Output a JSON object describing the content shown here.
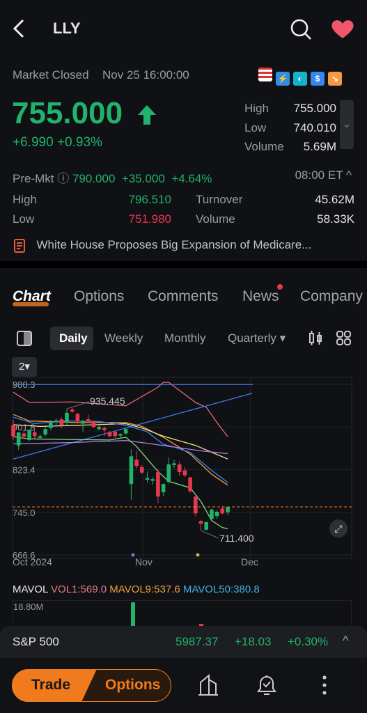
{
  "header": {
    "title": "LLY",
    "back_icon": "chevron-left",
    "search_icon": "search",
    "favorite_icon": "heart",
    "favorite_color": "#f0566c"
  },
  "status": {
    "market": "Market Closed",
    "time": "Nov 25 16:00:00"
  },
  "badges": [
    "us-flag",
    "lightning-2",
    "logo-teal",
    "dollar",
    "trend-down"
  ],
  "quote": {
    "price": "755.000",
    "change": "+6.990",
    "change_pct": "+0.93%",
    "high_label": "High",
    "high": "755.000",
    "low_label": "Low",
    "low": "740.010",
    "volume_label": "Volume",
    "volume": "5.69M"
  },
  "premarket": {
    "label": "Pre-Mkt",
    "price": "790.000",
    "change": "+35.000",
    "change_pct": "+4.64%",
    "time": "08:00 ET",
    "high_label": "High",
    "high": "796.510",
    "low_label": "Low",
    "low": "751.980",
    "turnover_label": "Turnover",
    "turnover": "45.62M",
    "volume_label": "Volume",
    "volume": "58.33K"
  },
  "news": {
    "headline": "White House Proposes Big Expansion of Medicare..."
  },
  "tabs": [
    {
      "label": "Chart",
      "active": true
    },
    {
      "label": "Options"
    },
    {
      "label": "Comments"
    },
    {
      "label": "News",
      "dot": true
    },
    {
      "label": "Company"
    }
  ],
  "periods": [
    {
      "label": "Daily",
      "active": true
    },
    {
      "label": "Weekly"
    },
    {
      "label": "Monthly"
    },
    {
      "label": "Quarterly ▾"
    }
  ],
  "chart_selector": "2▾",
  "chart_data": {
    "type": "candlestick",
    "y_ticks": [
      "980.3",
      "901.8",
      "823.4",
      "745.0",
      "666.6"
    ],
    "ylim": [
      666.6,
      980.3
    ],
    "x_labels": [
      "Oct 2024",
      "Nov",
      "Dec"
    ],
    "annotations": {
      "high": "935.445",
      "low": "711.400"
    },
    "last_price": 755.0,
    "candles": [
      [
        905,
        915,
        878,
        885
      ],
      [
        868,
        872,
        860,
        892
      ],
      [
        890,
        895,
        880,
        884
      ],
      [
        878,
        898,
        876,
        896
      ],
      [
        892,
        897,
        880,
        885
      ],
      [
        882,
        889,
        878,
        885
      ],
      [
        888,
        902,
        885,
        898
      ],
      [
        900,
        915,
        896,
        910
      ],
      [
        912,
        918,
        905,
        914
      ],
      [
        916,
        920,
        900,
        905
      ],
      [
        910,
        935.445,
        905,
        928
      ],
      [
        934,
        937,
        928,
        930
      ],
      [
        926,
        928,
        908,
        912
      ],
      [
        908,
        915,
        893,
        913
      ],
      [
        916,
        925,
        910,
        912
      ],
      [
        912,
        914,
        900,
        902
      ],
      [
        898,
        905,
        895,
        902
      ],
      [
        900,
        903,
        885,
        896
      ],
      [
        892,
        895,
        883,
        885
      ],
      [
        893,
        895,
        882,
        885
      ],
      [
        886,
        890,
        882,
        889
      ],
      [
        890,
        900,
        888,
        898
      ],
      [
        797,
        861,
        768,
        848
      ],
      [
        842,
        858,
        826,
        830
      ],
      [
        828,
        832,
        815,
        818
      ],
      [
        805,
        820,
        800,
        808
      ],
      [
        803,
        810,
        796,
        806
      ],
      [
        819,
        824,
        762,
        774
      ],
      [
        782,
        798,
        775,
        797
      ],
      [
        801,
        846,
        798,
        833
      ],
      [
        832,
        842,
        826,
        835
      ],
      [
        833,
        838,
        812,
        819
      ],
      [
        822,
        828,
        810,
        813
      ],
      [
        809,
        810,
        781,
        784
      ],
      [
        774,
        777,
        738,
        743
      ],
      [
        729,
        731,
        711.4,
        724
      ],
      [
        713,
        727,
        712,
        727
      ],
      [
        733,
        752,
        731,
        750
      ],
      [
        738,
        749,
        733,
        746
      ],
      [
        752,
        757,
        741,
        743
      ],
      [
        745,
        755,
        740,
        755
      ]
    ],
    "lines": [
      {
        "color": "#e36a78",
        "points": [
          [
            0,
            966
          ],
          [
            3,
            947
          ],
          [
            11,
            948
          ],
          [
            21,
            941
          ],
          [
            27,
            975
          ],
          [
            28,
            984
          ],
          [
            29,
            984
          ],
          [
            34,
            947
          ],
          [
            36,
            938
          ],
          [
            38,
            910
          ],
          [
            40,
            884
          ]
        ]
      },
      {
        "color": "#3d7bea",
        "points": [
          [
            0,
            980
          ],
          [
            44.7,
            980
          ]
        ]
      },
      {
        "color": "#3d7bea",
        "points": [
          [
            0,
            843
          ],
          [
            44.6,
            964
          ]
        ]
      },
      {
        "color": "#f0a040",
        "points": [
          [
            0,
            925
          ],
          [
            3,
            913
          ],
          [
            12,
            910
          ],
          [
            21,
            910
          ],
          [
            24,
            903
          ],
          [
            28,
            883
          ],
          [
            33,
            852
          ],
          [
            37,
            815
          ],
          [
            40,
            795
          ]
        ]
      },
      {
        "color": "#f4e08a",
        "points": [
          [
            0,
            906
          ],
          [
            5,
            903
          ],
          [
            12,
            905
          ],
          [
            21,
            908
          ],
          [
            24,
            900
          ],
          [
            28,
            885
          ],
          [
            34,
            868
          ],
          [
            40,
            843
          ]
        ]
      },
      {
        "color": "#3f82f0",
        "points": [
          [
            0,
            920
          ],
          [
            4,
            908
          ],
          [
            10,
            913
          ],
          [
            16,
            912
          ],
          [
            21,
            905
          ],
          [
            25,
            893
          ],
          [
            28,
            870
          ],
          [
            30,
            865
          ],
          [
            33,
            855
          ],
          [
            37,
            822
          ],
          [
            40,
            800
          ]
        ]
      },
      {
        "color": "#b07ee0",
        "points": [
          [
            0,
            871
          ],
          [
            10,
            873
          ],
          [
            21,
            877
          ],
          [
            25,
            872
          ],
          [
            30,
            865
          ],
          [
            35,
            858
          ],
          [
            40,
            853
          ]
        ]
      },
      {
        "color": "#7fd67f",
        "points": [
          [
            0,
            884
          ],
          [
            3,
            880
          ],
          [
            10,
            879
          ],
          [
            18,
            878
          ],
          [
            21,
            883
          ],
          [
            23,
            866
          ],
          [
            27,
            820
          ],
          [
            29,
            802
          ],
          [
            33,
            790
          ],
          [
            35,
            765
          ],
          [
            37,
            730
          ],
          [
            39,
            717
          ],
          [
            40,
            715
          ]
        ]
      }
    ]
  },
  "mavol": {
    "title": "MAVOL",
    "vol1": "VOL1:569.0",
    "mavol9": "MAVOL9:537.6",
    "mavol50": "MAVOL50:380.8",
    "max": "18.80M"
  },
  "index": {
    "name": "S&P 500",
    "value": "5987.37",
    "change": "+18.03",
    "change_pct": "+0.30%"
  },
  "bottom": {
    "trade": "Trade",
    "options": "Options"
  },
  "colors": {
    "up": "#21b36b",
    "down": "#e8384f",
    "accent": "#f07a1e"
  }
}
